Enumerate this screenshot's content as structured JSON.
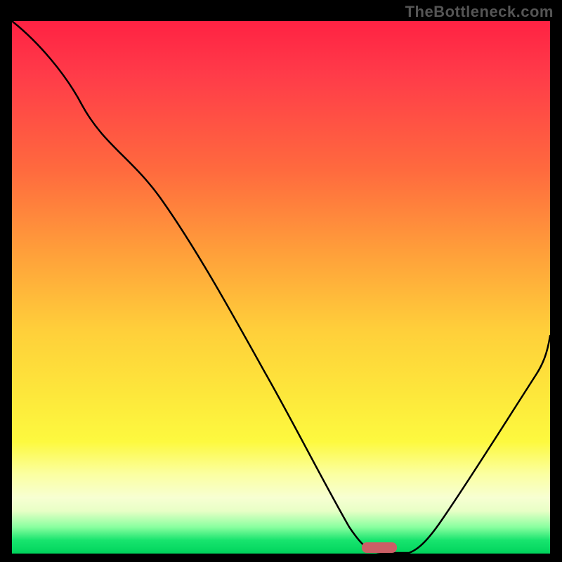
{
  "watermark": "TheBottleneck.com",
  "chart_data": {
    "type": "line",
    "title": "",
    "xlabel": "",
    "ylabel": "",
    "xlim": [
      0,
      100
    ],
    "ylim": [
      0,
      100
    ],
    "x": [
      0,
      5,
      10,
      15,
      20,
      25,
      30,
      35,
      40,
      45,
      50,
      55,
      58,
      60,
      63,
      66,
      70,
      75,
      80,
      85,
      90,
      95,
      100
    ],
    "values": [
      100,
      96,
      90,
      84,
      78,
      74.5,
      69,
      59,
      49,
      39,
      29,
      18,
      12,
      8,
      4,
      1,
      0,
      0.3,
      6,
      14,
      23,
      32,
      41
    ],
    "background_gradient": {
      "stops": [
        {
          "pos": 0,
          "color": "#ff2243"
        },
        {
          "pos": 10,
          "color": "#ff3b49"
        },
        {
          "pos": 28,
          "color": "#ff6a3e"
        },
        {
          "pos": 44,
          "color": "#ffa13a"
        },
        {
          "pos": 58,
          "color": "#ffcf3a"
        },
        {
          "pos": 70,
          "color": "#fde73b"
        },
        {
          "pos": 79,
          "color": "#fdf93f"
        },
        {
          "pos": 85,
          "color": "#fbffa0"
        },
        {
          "pos": 89.5,
          "color": "#f7ffd2"
        },
        {
          "pos": 92,
          "color": "#e8ffc6"
        },
        {
          "pos": 95,
          "color": "#8affa0"
        },
        {
          "pos": 97.5,
          "color": "#18e46e"
        },
        {
          "pos": 100,
          "color": "#00d45c"
        }
      ]
    },
    "marker": {
      "x": 69,
      "y": 0,
      "width_pct": 6,
      "height_pct": 2.2,
      "color": "#cc5f66"
    }
  }
}
